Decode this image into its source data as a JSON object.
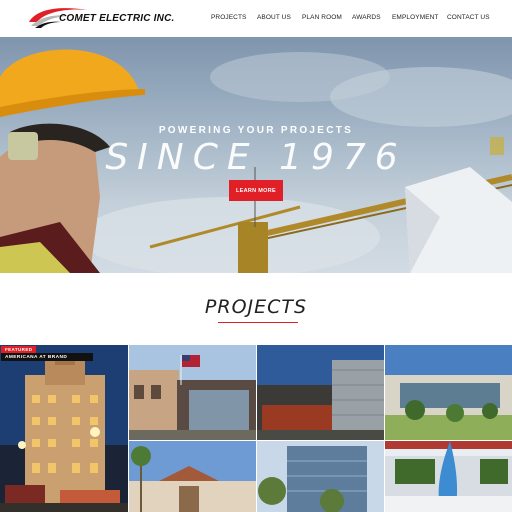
{
  "header": {
    "logo_text": "COMET ELECTRIC INC.",
    "nav": [
      {
        "label": "PROJECTS"
      },
      {
        "label": "ABOUT US"
      },
      {
        "label": "PLAN ROOM"
      },
      {
        "label": "AWARDS"
      },
      {
        "label": "EMPLOYMENT"
      },
      {
        "label": "CONTACT US"
      }
    ]
  },
  "hero": {
    "tagline": "POWERING YOUR PROJECTS",
    "title": "SINCE 1976",
    "button_label": "LEARN MORE"
  },
  "projects": {
    "heading": "PROJECTS",
    "featured_badge": "FEATURED",
    "featured_title": "AMERICANA AT BRAND"
  },
  "colors": {
    "accent": "#e02026",
    "text": "#222222"
  }
}
